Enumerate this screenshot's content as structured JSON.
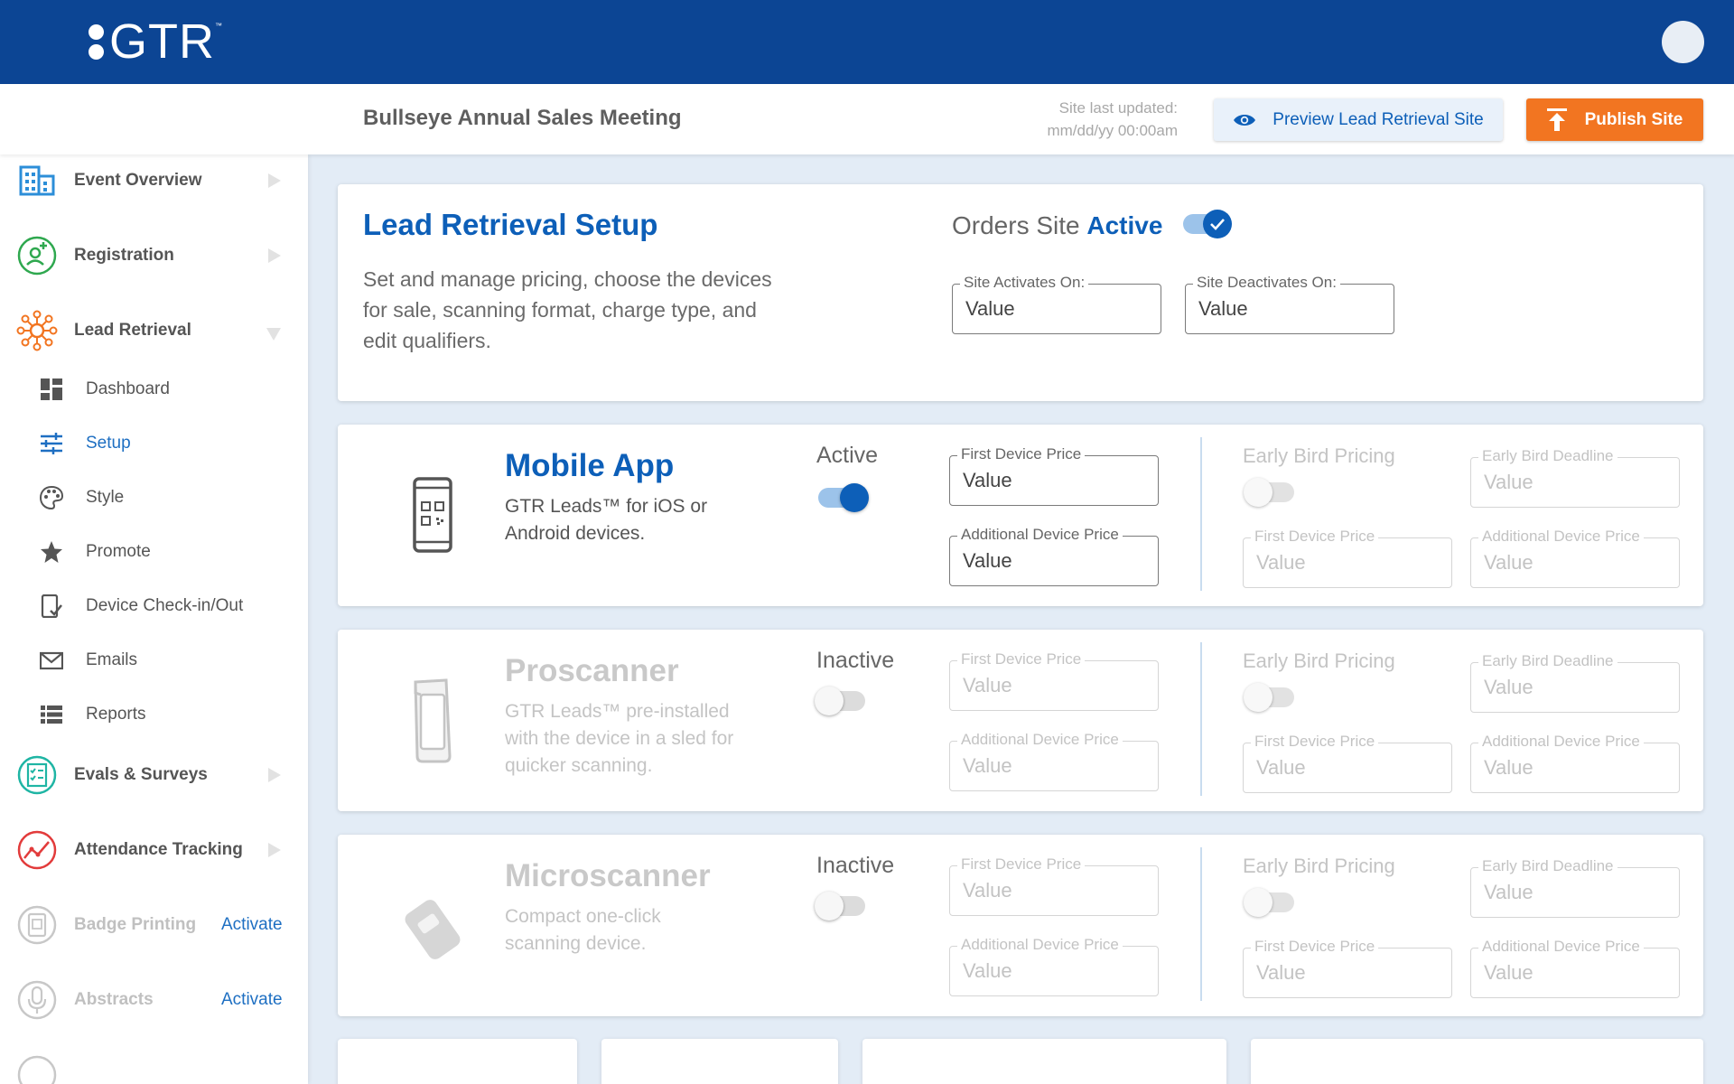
{
  "brand": {
    "logo_text": "GTR",
    "logo_tm": "™"
  },
  "header": {
    "event_title": "Bullseye Annual Sales Meeting",
    "last_updated_label": "Site last updated:",
    "last_updated_value": "mm/dd/yy 00:00am",
    "preview_label": "Preview Lead Retrieval Site",
    "publish_label": "Publish Site"
  },
  "sidebar": {
    "items": [
      {
        "label": "Event Overview",
        "icon": "building-icon"
      },
      {
        "label": "Registration",
        "icon": "add-user-icon"
      },
      {
        "label": "Lead Retrieval",
        "icon": "network-icon",
        "expanded": true
      },
      {
        "label": "Evals & Surveys",
        "icon": "checklist-icon"
      },
      {
        "label": "Attendance Tracking",
        "icon": "trend-icon"
      },
      {
        "label": "Badge Printing",
        "icon": "badge-icon",
        "disabled": true,
        "action": "Activate"
      },
      {
        "label": "Abstracts",
        "icon": "microphone-icon",
        "disabled": true,
        "action": "Activate"
      }
    ],
    "subitems": [
      {
        "label": "Dashboard",
        "icon": "dashboard-icon"
      },
      {
        "label": "Setup",
        "icon": "sliders-icon",
        "active": true
      },
      {
        "label": "Style",
        "icon": "palette-icon"
      },
      {
        "label": "Promote",
        "icon": "star-icon"
      },
      {
        "label": "Device Check-in/Out",
        "icon": "device-check-icon"
      },
      {
        "label": "Emails",
        "icon": "mail-icon"
      },
      {
        "label": "Reports",
        "icon": "list-icon"
      }
    ]
  },
  "setup": {
    "title": "Lead Retrieval Setup",
    "description": "Set and manage pricing, choose the devices for sale, scanning format, charge type, and edit qualifiers.",
    "orders_prefix": "Orders Site",
    "orders_status": "Active",
    "orders_toggle_on": true,
    "activates_label": "Site Activates On:",
    "activates_value": "Value",
    "deactivates_label": "Site Deactivates On:",
    "deactivates_value": "Value"
  },
  "devices": [
    {
      "title": "Mobile App",
      "description": "GTR Leads™ for iOS or Android devices.",
      "status": "Active",
      "toggle_on": true,
      "first_price_label": "First Device Price",
      "first_price_value": "Value",
      "additional_price_label": "Additional Device Price",
      "additional_price_value": "Value",
      "early_bird_label": "Early Bird Pricing",
      "eb_deadline_label": "Early Bird Deadline",
      "eb_deadline_value": "Value",
      "eb_first_label": "First Device Price",
      "eb_first_value": "Value",
      "eb_additional_label": "Additional Device Price",
      "eb_additional_value": "Value"
    },
    {
      "title": "Proscanner",
      "description": "GTR Leads™ pre-installed with the device in a sled for quicker scanning.",
      "status": "Inactive",
      "toggle_on": false,
      "first_price_label": "First Device Price",
      "first_price_value": "Value",
      "additional_price_label": "Additional Device Price",
      "additional_price_value": "Value",
      "early_bird_label": "Early Bird Pricing",
      "eb_deadline_label": "Early Bird Deadline",
      "eb_deadline_value": "Value",
      "eb_first_label": "First Device Price",
      "eb_first_value": "Value",
      "eb_additional_label": "Additional Device Price",
      "eb_additional_value": "Value"
    },
    {
      "title": "Microscanner",
      "description": "Compact one-click scanning device.",
      "status": "Inactive",
      "toggle_on": false,
      "first_price_label": "First Device Price",
      "first_price_value": "Value",
      "additional_price_label": "Additional Device Price",
      "additional_price_value": "Value",
      "early_bird_label": "Early Bird Pricing",
      "eb_deadline_label": "Early Bird Deadline",
      "eb_deadline_value": "Value",
      "eb_first_label": "First Device Price",
      "eb_first_value": "Value",
      "eb_additional_label": "Additional Device Price",
      "eb_additional_value": "Value"
    }
  ],
  "colors": {
    "brand_blue": "#0c4594",
    "accent_blue": "#0d5fb8",
    "publish_orange": "#f27521",
    "background": "#e3ecf6"
  }
}
